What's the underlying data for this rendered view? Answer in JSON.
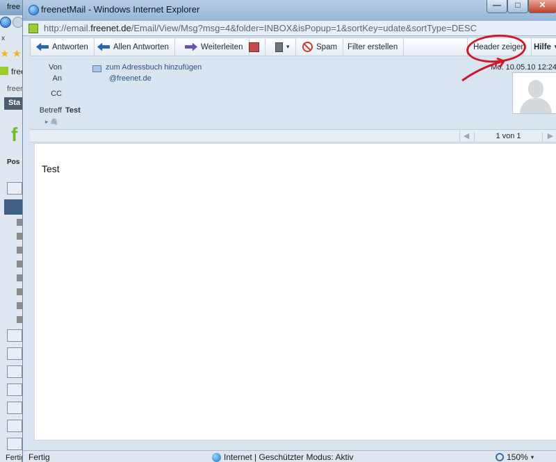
{
  "background_window": {
    "title_fragment": "free",
    "tab_fragment": "free",
    "nav_fragment": "freen",
    "section_fragment": "Sta",
    "panel_fragment": "Pos",
    "x_fragment": "x",
    "status": "Fertig"
  },
  "window": {
    "title": "freenetMail - Windows Internet Explorer",
    "min_glyph": "—",
    "max_glyph": "□",
    "close_glyph": "✕"
  },
  "address": {
    "prefix": "http://email.",
    "domain": "freenet.de",
    "suffix": "/Email/View/Msg?msg=4&folder=INBOX&isPopup=1&sortKey=udate&sortType=DESC"
  },
  "toolbar": {
    "reply": "Antworten",
    "reply_all": "Allen Antworten",
    "forward": "Weiterleiten",
    "spam": "Spam",
    "filter": "Filter erstellen",
    "header": "Header zeigen",
    "help": "Hilfe"
  },
  "header": {
    "from_label": "Von",
    "to_label": "An",
    "cc_label": "CC",
    "subject_label": "Betreff",
    "add_to_addressbook": "zum Adressbuch hinzufügen",
    "to_value": "@freenet.de",
    "subject_value": "Test",
    "date": "Mo. 10.05.10 12:24",
    "attach_glyph": "▸ 🖇"
  },
  "pager": {
    "text": "1 von 1",
    "prev_glyph": "◀",
    "next_glyph": "▶"
  },
  "message": {
    "body": "Test"
  },
  "status": {
    "left": "Fertig",
    "zone": "Internet | Geschützter Modus: Aktiv",
    "zoom": "150%"
  },
  "colors": {
    "annotation": "#d3172a"
  }
}
